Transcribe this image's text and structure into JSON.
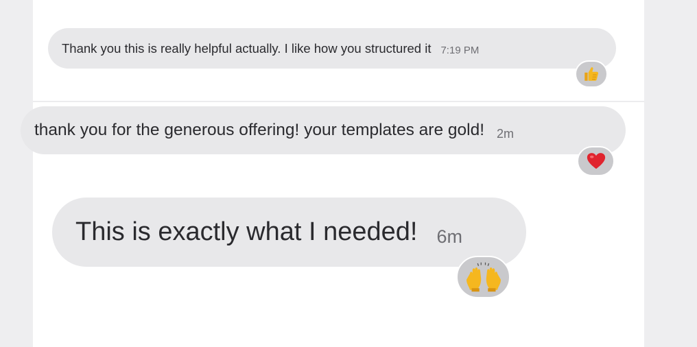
{
  "messages": [
    {
      "text": "Thank you this is really helpful actually. I like how you structured it",
      "time": "7:19 PM",
      "reaction": "thumbs-up-icon"
    },
    {
      "text": "thank you for the generous offering! your templates are gold!",
      "time": "2m",
      "reaction": "heart-icon"
    },
    {
      "text": "This is exactly what I needed!",
      "time": "6m",
      "reaction": "raising-hands-icon"
    }
  ],
  "colors": {
    "bubble": "#e8e8ea",
    "reaction_bg": "#c9c9cc",
    "text": "#2a2a2e",
    "time": "#6e6e73",
    "heart": "#e0242e",
    "emoji_yellow": "#f5b71f"
  }
}
